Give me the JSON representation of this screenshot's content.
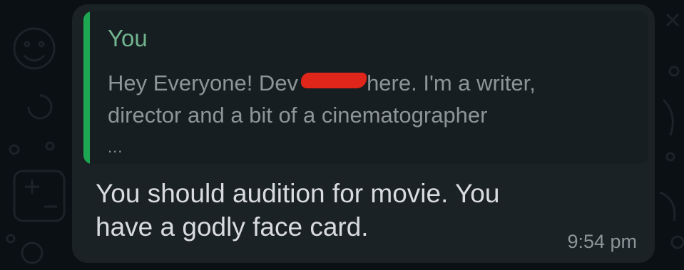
{
  "message": {
    "quoted": {
      "author": "You",
      "text_before_redaction": "Hey Everyone! Dev",
      "text_after_redaction": "here. I'm a writer,",
      "text_line2": "director and a bit of a cinematographer",
      "ellipsis": "..."
    },
    "body_line1": "You should audition for movie. You",
    "body_line2": "have a godly face card.",
    "time": "9:54 pm"
  },
  "colors": {
    "background": "#0b1014",
    "bubble": "#1b2225",
    "quote_bar": "#1da752",
    "quote_author": "#71b38f",
    "redaction": "#e0261b"
  }
}
